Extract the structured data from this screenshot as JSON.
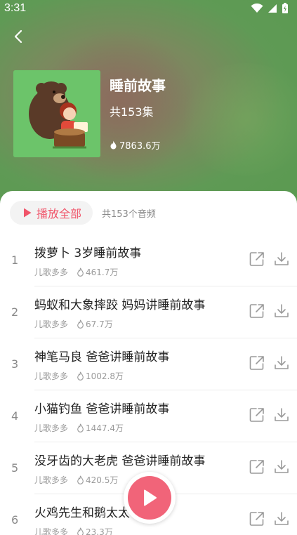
{
  "status_bar": {
    "time": "3:31"
  },
  "album": {
    "title": "睡前故事",
    "episode_count": "共153集",
    "plays": "7863.6万"
  },
  "toolbar": {
    "play_all_label": "播放全部",
    "total_tracks": "共153个音频"
  },
  "tracks": [
    {
      "index": "1",
      "title": "拨萝卜 3岁睡前故事",
      "author": "儿歌多多",
      "plays": "461.7万"
    },
    {
      "index": "2",
      "title": "蚂蚁和大象摔跤  妈妈讲睡前故事",
      "author": "儿歌多多",
      "plays": "67.7万"
    },
    {
      "index": "3",
      "title": "神笔马良  爸爸讲睡前故事",
      "author": "儿歌多多",
      "plays": "1002.8万"
    },
    {
      "index": "4",
      "title": "小猫钓鱼  爸爸讲睡前故事",
      "author": "儿歌多多",
      "plays": "1447.4万"
    },
    {
      "index": "5",
      "title": "没牙齿的大老虎  爸爸讲睡前故事",
      "author": "儿歌多多",
      "plays": "420.5万"
    },
    {
      "index": "6",
      "title": "火鸡先生和鹅太太",
      "author": "儿歌多多",
      "plays": "23.3万"
    }
  ],
  "icons": {
    "back": "chevron-left-icon",
    "play_all": "play-triangle-icon",
    "flame": "flame-icon",
    "share": "share-icon",
    "download": "download-icon",
    "fab": "play-icon"
  },
  "colors": {
    "accent": "#f16479",
    "header_green": "#5f9a55",
    "muted_text": "#9a9a9a"
  }
}
